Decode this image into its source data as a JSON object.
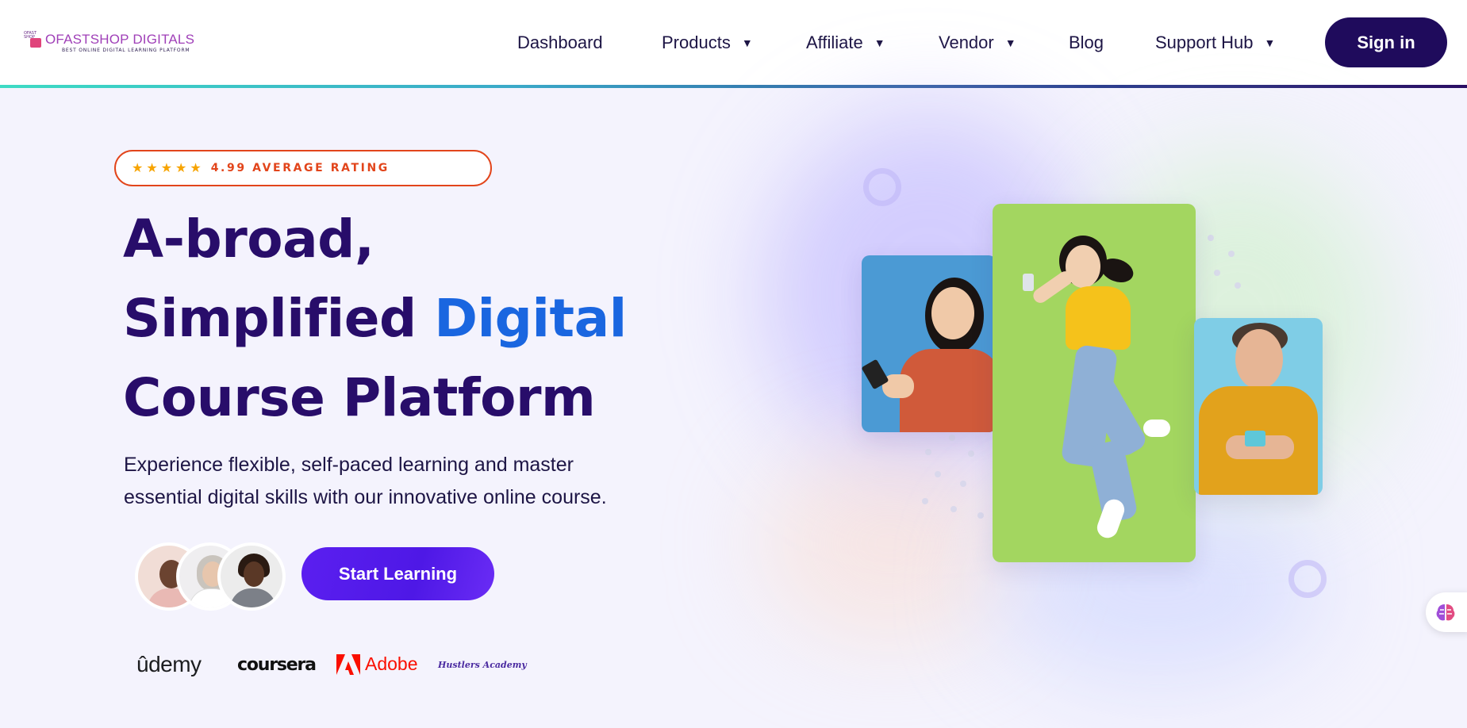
{
  "logo": {
    "name": "OFASTSHOP DIGITALS",
    "tagline": "BEST ONLINE DIGITAL LEARNING PLATFORM",
    "mark_text": "OFAST SHOP"
  },
  "nav": {
    "items": [
      {
        "label": "Dashboard",
        "dropdown": false
      },
      {
        "label": "Products",
        "dropdown": true
      },
      {
        "label": "Affiliate",
        "dropdown": true
      },
      {
        "label": "Vendor",
        "dropdown": true
      },
      {
        "label": "Blog",
        "dropdown": false
      },
      {
        "label": "Support Hub",
        "dropdown": true
      }
    ],
    "caret": "▼",
    "signin_label": "Sign in"
  },
  "hero": {
    "rating": {
      "stars": 5,
      "text": "4.99 AVERAGE RATING"
    },
    "headline": {
      "line1": "A-broad,",
      "line2_start": "Simplified ",
      "line2_highlight": "Digital",
      "line3": "Course Platform"
    },
    "subtext_line1": "Experience flexible, self-paced learning and master",
    "subtext_line2": "essential digital skills with our innovative online course.",
    "cta_label": "Start Learning",
    "partners": {
      "udemy": "ûdemy",
      "coursera": "coursera",
      "adobe": "Adobe",
      "hustlers": "Hustlers Academy"
    }
  },
  "colors": {
    "primary": "#1f0b5c",
    "headline": "#280d6a",
    "highlight": "#1a66e0",
    "cta": "#5b1ff0",
    "rating": "#e2451b",
    "star": "#f7a400"
  },
  "icons": {
    "star": "★",
    "chat_widget": "brain-icon"
  }
}
